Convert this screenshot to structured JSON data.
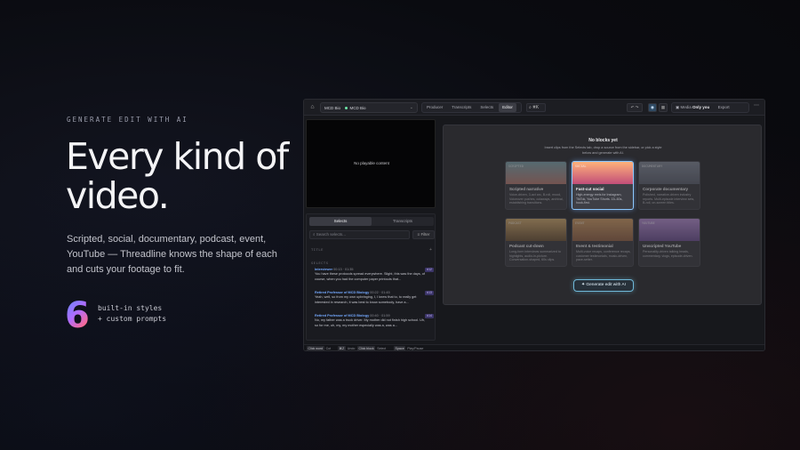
{
  "hero": {
    "eyebrow": "GENERATE EDIT WITH AI",
    "headline": "Every kind of video.",
    "subcopy": "Scripted, social, documentary, podcast, event, YouTube — Threadline knows the shape of each and cuts your footage to fit.",
    "count": "6",
    "count_caption_1": "built-in styles",
    "count_caption_2": "+ custom prompts",
    "gradient_colors": [
      "#5b8cff",
      "#b06cff",
      "#ff6a8a",
      "#ffae5c"
    ]
  },
  "app": {
    "home_icon": "home-icon",
    "project": {
      "root": "MCD Bio",
      "current": "MCD Bio"
    },
    "modes": [
      "Producer",
      "Transcripts",
      "Selects",
      "Editor"
    ],
    "active_mode": "Editor",
    "search_shortcut": "⌘K",
    "media_label": "Media",
    "media_visibility": "Only you",
    "export_label": "Export",
    "preview_message": "No playable content",
    "side_tabs": [
      "Selects",
      "Transcripts"
    ],
    "side_search_placeholder": "Search selects...",
    "filter_label": "Filter",
    "section_title": "TITLE",
    "section_selects": "SELECTS",
    "clips": [
      {
        "speaker": "Interviewer",
        "time": "00:13 · 01:35",
        "badge": "#12",
        "text": "You have these protocols spread everywhere. Slight, this was the days, of course, when you had the computer paper printouts that..."
      },
      {
        "speaker": "Retired Professor of MCD Biology",
        "time": "00:22 · 01:45",
        "badge": "#13",
        "text": "Yeah, well, so from my own upbringing, I, I knew that to, to really get interested in research, it was best to know somebody, have a..."
      },
      {
        "speaker": "Retired Professor of MCD Biology",
        "time": "00:40 · 01:59",
        "badge": "#14",
        "text": "No, my father was a truck driver. My mother did not finish high school. Uh, so for me, uh, my, my mother especially was a, was a..."
      }
    ],
    "main": {
      "title": "No blocks yet",
      "subtitle": "Insert clips from the Selects tab, drop a source from the sidebar, or pick a style below and generate with AI.",
      "cards": [
        {
          "tag": "SCRIPTED",
          "name": "Scripted narrative",
          "desc": "Voice-driven, 3-act arc, B-roll, mood, Voiceover pushes, cutaways, archival, establishing transitions.",
          "thumb_from": "#7a9fa8",
          "thumb_to": "#b0776e",
          "selected": false,
          "dim": true
        },
        {
          "tag": "SOCIAL",
          "name": "Fast-cut social",
          "desc": "High-energy reels for Instagram, TikTok, YouTube Shorts. 15–60s, hook-first.",
          "thumb_from": "#ffb27a",
          "thumb_to": "#c24e79",
          "selected": true,
          "dim": false
        },
        {
          "tag": "DOCUMENTARY",
          "name": "Corporate documentary",
          "desc": "Polished, narrative-driven industry reports. Multi-episode interview sets, B-roll, on-screen titles.",
          "thumb_from": "#7e8492",
          "thumb_to": "#5a5e6b",
          "selected": false,
          "dim": true
        },
        {
          "tag": "PODCAST",
          "name": "Podcast cut-down",
          "desc": "Long-form interviews summarized to highlights, audio-in-picture. Conversation-shaped, 60s clips.",
          "thumb_from": "#c9a46a",
          "thumb_to": "#6b5136",
          "selected": false,
          "dim": true
        },
        {
          "tag": "EVENT",
          "name": "Event & testimonial",
          "desc": "Multi-voice recaps, conference recaps, customer testimonials, music-driven, pace-setter.",
          "thumb_from": "#c79762",
          "thumb_to": "#8c5f44",
          "selected": false,
          "dim": true
        },
        {
          "tag": "YOUTUBE",
          "name": "Unscripted YouTube",
          "desc": "Personality-driven talking heads, commentary, vlogs, episode-driven.",
          "thumb_from": "#b08acb",
          "thumb_to": "#6a4f8c",
          "selected": false,
          "dim": true
        }
      ],
      "generate_label": "Generate edit with AI"
    },
    "footer": [
      {
        "key": "Click word",
        "label": "Cut"
      },
      {
        "key": "⌘Z",
        "label": "Undo"
      },
      {
        "key": "Click block",
        "label": "Select"
      },
      {
        "key": "Space",
        "label": "Play/Pause"
      }
    ]
  }
}
